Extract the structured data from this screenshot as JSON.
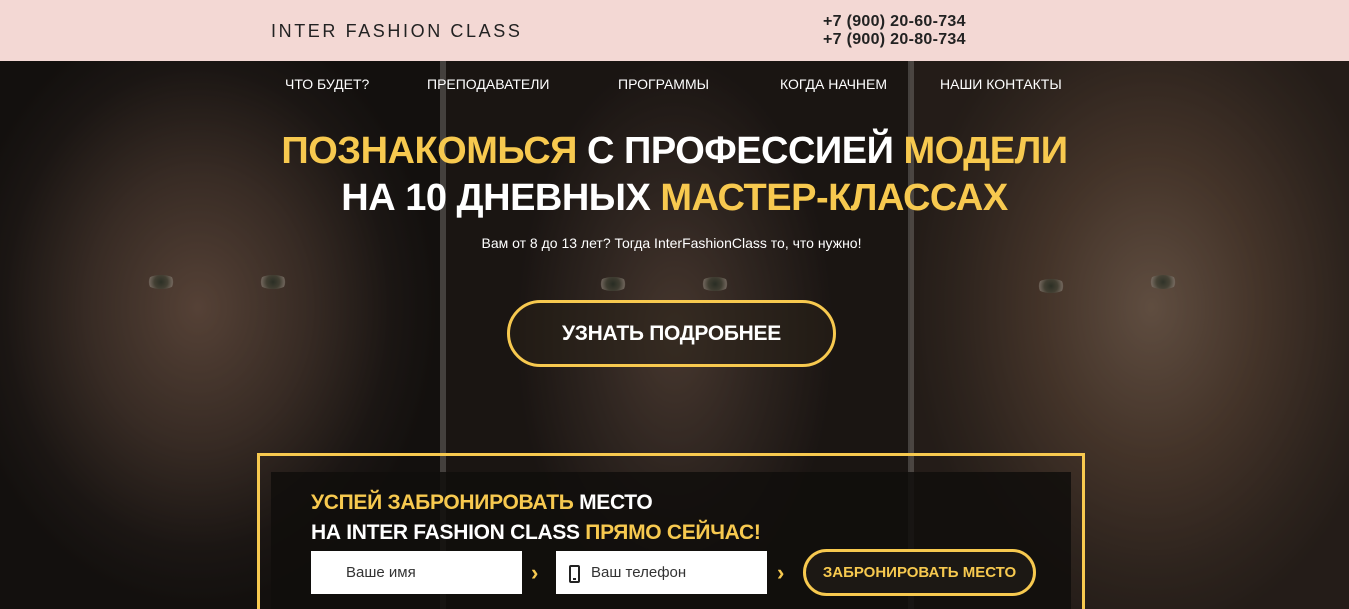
{
  "header": {
    "brand": "INTER FASHION CLASS",
    "phones": [
      "+7 (900) 20-60-734",
      "+7 (900) 20-80-734"
    ]
  },
  "nav": {
    "items": [
      "ЧТО БУДЕТ?",
      "ПРЕПОДАВАТЕЛИ",
      "ПРОГРАММЫ",
      "КОГДА НАЧНЕМ",
      "НАШИ КОНТАКТЫ"
    ]
  },
  "hero": {
    "headline_line1": [
      {
        "text": "ПОЗНАКОМЬСЯ",
        "accent": true
      },
      {
        "text": " С ПРОФЕССИЕЙ ",
        "accent": false
      },
      {
        "text": "МОДЕЛИ",
        "accent": true
      }
    ],
    "headline_line2": [
      {
        "text": "НА 10 ДНЕВНЫХ ",
        "accent": false
      },
      {
        "text": "МАСТЕР-КЛАССАХ",
        "accent": true
      }
    ],
    "subtitle": "Вам от 8 до 13 лет? Тогда InterFashionClass то, что нужно!",
    "cta_label": "УЗНАТЬ ПОДРОБНЕЕ"
  },
  "booking": {
    "title_line1": [
      {
        "text": "УСПЕЙ ЗАБРОНИРОВАТЬ",
        "accent": true
      },
      {
        "text": " МЕСТО",
        "accent": false
      }
    ],
    "title_line2": [
      {
        "text": "НА INTER FASHION CLASS ",
        "accent": false
      },
      {
        "text": "ПРЯМО СЕЙЧАС!",
        "accent": true
      }
    ],
    "name_placeholder": "Ваше имя",
    "phone_placeholder": "Ваш телефон",
    "submit_label": "ЗАБРОНИРОВАТЬ МЕСТО"
  },
  "colors": {
    "accent": "#f7c94f",
    "topbar": "#f3d8d4"
  },
  "icons": {
    "arrow": "chevron-right-icon",
    "phone": "mobile-phone-icon"
  }
}
